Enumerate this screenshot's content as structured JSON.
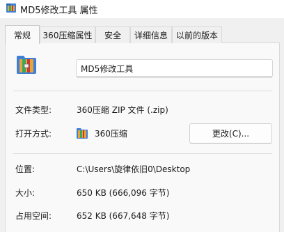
{
  "window": {
    "title": "MD5修改工具 属性",
    "title_icon": "winrar-archive-icon"
  },
  "tabs": [
    {
      "label": "常规",
      "active": true
    },
    {
      "label": "360压缩属性",
      "active": false
    },
    {
      "label": "安全",
      "active": false
    },
    {
      "label": "详细信息",
      "active": false
    },
    {
      "label": "以前的版本",
      "active": false
    }
  ],
  "general": {
    "file_icon": "winrar-archive-icon",
    "file_name": "MD5修改工具",
    "file_type_label": "文件类型:",
    "file_type_value": "360压缩 ZIP 文件 (.zip)",
    "open_with_label": "打开方式:",
    "open_with_app": "360压缩",
    "open_with_icon": "360zip-app-icon",
    "change_button": "更改(C)...",
    "location_label": "位置:",
    "location_value": "C:\\Users\\旋律依旧0\\Desktop",
    "size_label": "大小:",
    "size_value": "650 KB (666,096 字节)",
    "size_on_disk_label": "占用空间:",
    "size_on_disk_value": "652 KB (667,648 字节)"
  },
  "colors": {
    "panel_bg": "#f9f9f9",
    "window_bg": "#f0f0f0",
    "archive_blue": "#3f7fd6",
    "archive_orange": "#e8a33a",
    "archive_green": "#3aaa5a"
  }
}
